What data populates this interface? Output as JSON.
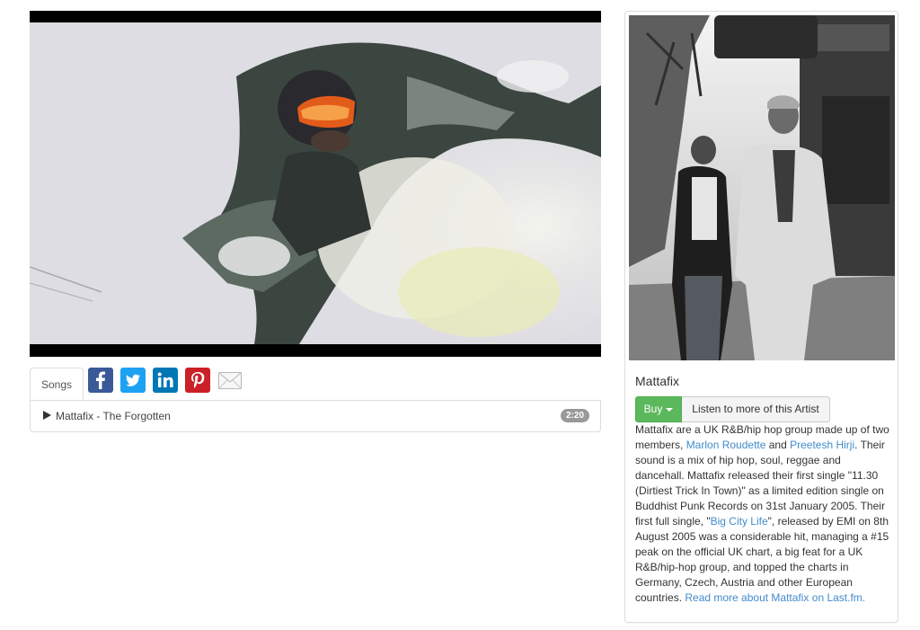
{
  "video": {
    "description_icon": "video-player"
  },
  "tabs": {
    "songs_label": "Songs"
  },
  "share": {
    "facebook": {
      "icon": "facebook-icon",
      "color": "#3b5998"
    },
    "twitter": {
      "icon": "twitter-icon",
      "color": "#1da1f2"
    },
    "linkedin": {
      "icon": "linkedin-icon",
      "color": "#0077b5"
    },
    "pinterest": {
      "icon": "pinterest-icon",
      "color": "#cb2027"
    },
    "email": {
      "icon": "email-icon",
      "color": "#b8b8b8"
    }
  },
  "songs": [
    {
      "title": "Mattafix - The Forgotten",
      "duration": "2:20"
    }
  ],
  "artist": {
    "name": "Mattafix",
    "buy_label": "Buy",
    "listen_label": "Listen to more of this Artist",
    "bio": {
      "p1": "Mattafix are a UK R&B/hip hop group made up of two members, ",
      "link_marlon": "Marlon Roudette",
      "p2": " and ",
      "link_preetesh": "Preetesh Hirji",
      "p3": ". Their sound is a mix of hip hop, soul, reggae and dancehall. Mattafix released their first single \"11.30 (Dirtiest Trick In Town)\" as a limited edition single on Buddhist Punk Records on 31st January 2005. Their first full single, \"",
      "link_bigcity": "Big City Life",
      "p4": "\", released by EMI on 8th August 2005 was a considerable hit, managing a #15 peak on the official UK chart, a big feat for a UK R&B/hip-hop group, and topped the charts in Germany, Czech, Austria and other European countries. ",
      "link_readmore": "Read more about Mattafix on Last.fm."
    }
  },
  "colors": {
    "accent_green": "#5cb85c",
    "link": "#428bca",
    "badge": "#999999"
  }
}
